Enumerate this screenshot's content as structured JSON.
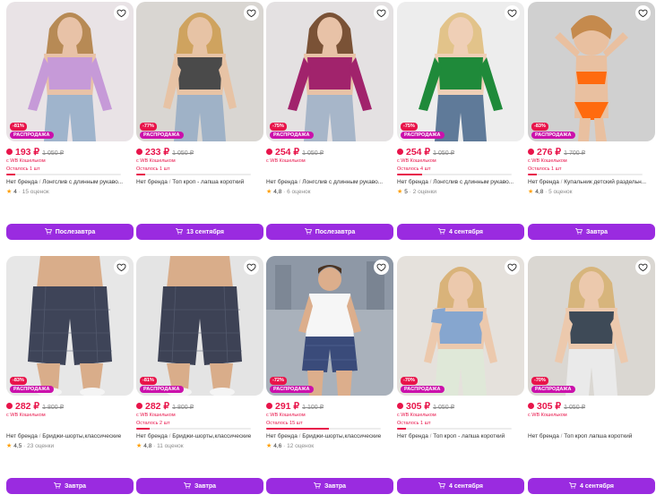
{
  "currency": "₽",
  "wallet_label": "с WB Кошельком",
  "sale_label": "РАСПРОДАЖА",
  "separator": "/",
  "products": [
    {
      "discount": "-81%",
      "price": "193 ₽",
      "old_price": "1 050 ₽",
      "wallet": "с WB Кошельком",
      "left": "Осталось 1 шт",
      "left_fraction": 0.08,
      "brand": "Нет бренда",
      "title": "Лонгслив с длинным рукаво...",
      "rating": "4",
      "reviews": "15 оценок",
      "delivery": "Послезавтра",
      "photo_theme": "lilac-top"
    },
    {
      "discount": "-77%",
      "price": "233 ₽",
      "old_price": "1 050 ₽",
      "wallet": "с WB Кошельком",
      "left": "Осталось 1 шт",
      "left_fraction": 0.08,
      "brand": "Нет бренда",
      "title": "Топ кроп - лапша короткий",
      "rating": "",
      "reviews": "",
      "delivery": "13 сентября",
      "photo_theme": "gray-top"
    },
    {
      "discount": "-75%",
      "price": "254 ₽",
      "old_price": "1 050 ₽",
      "wallet": "с WB Кошельком",
      "left": "",
      "left_fraction": 0,
      "brand": "Нет бренда",
      "title": "Лонгслив с длинным рукаво...",
      "rating": "4,8",
      "reviews": "6 оценок",
      "delivery": "Послезавтра",
      "photo_theme": "magenta-top"
    },
    {
      "discount": "-75%",
      "price": "254 ₽",
      "old_price": "1 050 ₽",
      "wallet": "с WB Кошельком",
      "left": "Осталось 4 шт",
      "left_fraction": 0.22,
      "brand": "Нет бренда",
      "title": "Лонгслив с длинным рукаво...",
      "rating": "5",
      "reviews": "2 оценки",
      "delivery": "4 сентября",
      "photo_theme": "green-top"
    },
    {
      "discount": "-83%",
      "price": "276 ₽",
      "old_price": "1 700 ₽",
      "wallet": "с WB Кошельком",
      "left": "Осталось 1 шт",
      "left_fraction": 0.08,
      "brand": "Нет бренда",
      "title": "Купальник детский раздельн...",
      "rating": "4,8",
      "reviews": "5 оценок",
      "delivery": "Завтра",
      "photo_theme": "orange-swim"
    },
    {
      "discount": "-83%",
      "price": "282 ₽",
      "old_price": "1 800 ₽",
      "wallet": "с WB Кошельком",
      "left": "",
      "left_fraction": 0,
      "brand": "Нет бренда",
      "title": "Бриджи-шорты,классические",
      "rating": "4,5",
      "reviews": "23 оценки",
      "delivery": "Завтра",
      "photo_theme": "shorts-a"
    },
    {
      "discount": "-81%",
      "price": "282 ₽",
      "old_price": "1 800 ₽",
      "wallet": "с WB Кошельком",
      "left": "Осталось 2 шт",
      "left_fraction": 0.12,
      "brand": "Нет бренда",
      "title": "Бриджи-шорты,классические",
      "rating": "4,8",
      "reviews": "11 оценок",
      "delivery": "Завтра",
      "photo_theme": "shorts-b"
    },
    {
      "discount": "-72%",
      "price": "291 ₽",
      "old_price": "1 100 ₽",
      "wallet": "с WB Кошельком",
      "left": "Осталось 15 шт",
      "left_fraction": 0.55,
      "brand": "Нет бренда",
      "title": "Бриджи-шорты,классические",
      "rating": "4,6",
      "reviews": "12 оценок",
      "delivery": "Завтра",
      "photo_theme": "shorts-c"
    },
    {
      "discount": "-70%",
      "price": "305 ₽",
      "old_price": "1 050 ₽",
      "wallet": "с WB Кошельком",
      "left": "Осталось 1 шт",
      "left_fraction": 0.08,
      "brand": "Нет бренда",
      "title": "Топ кроп - лапша короткий",
      "rating": "",
      "reviews": "",
      "delivery": "4 сентября",
      "photo_theme": "blue-top"
    },
    {
      "discount": "-70%",
      "price": "305 ₽",
      "old_price": "1 050 ₽",
      "wallet": "с WB Кошельком",
      "left": "",
      "left_fraction": 0,
      "brand": "Нет бренда",
      "title": "Топ кроп лапша короткий",
      "rating": "",
      "reviews": "",
      "delivery": "4 сентября",
      "photo_theme": "dark-top"
    }
  ],
  "colors": {
    "price": "#e8144a",
    "button": "#9a2be0",
    "sale": "#cb11ab",
    "star": "#ff9f00"
  },
  "icons": {
    "favorite": "heart-icon",
    "cart": "cart-icon",
    "rating": "star-icon",
    "wallet": "wallet-icon"
  }
}
